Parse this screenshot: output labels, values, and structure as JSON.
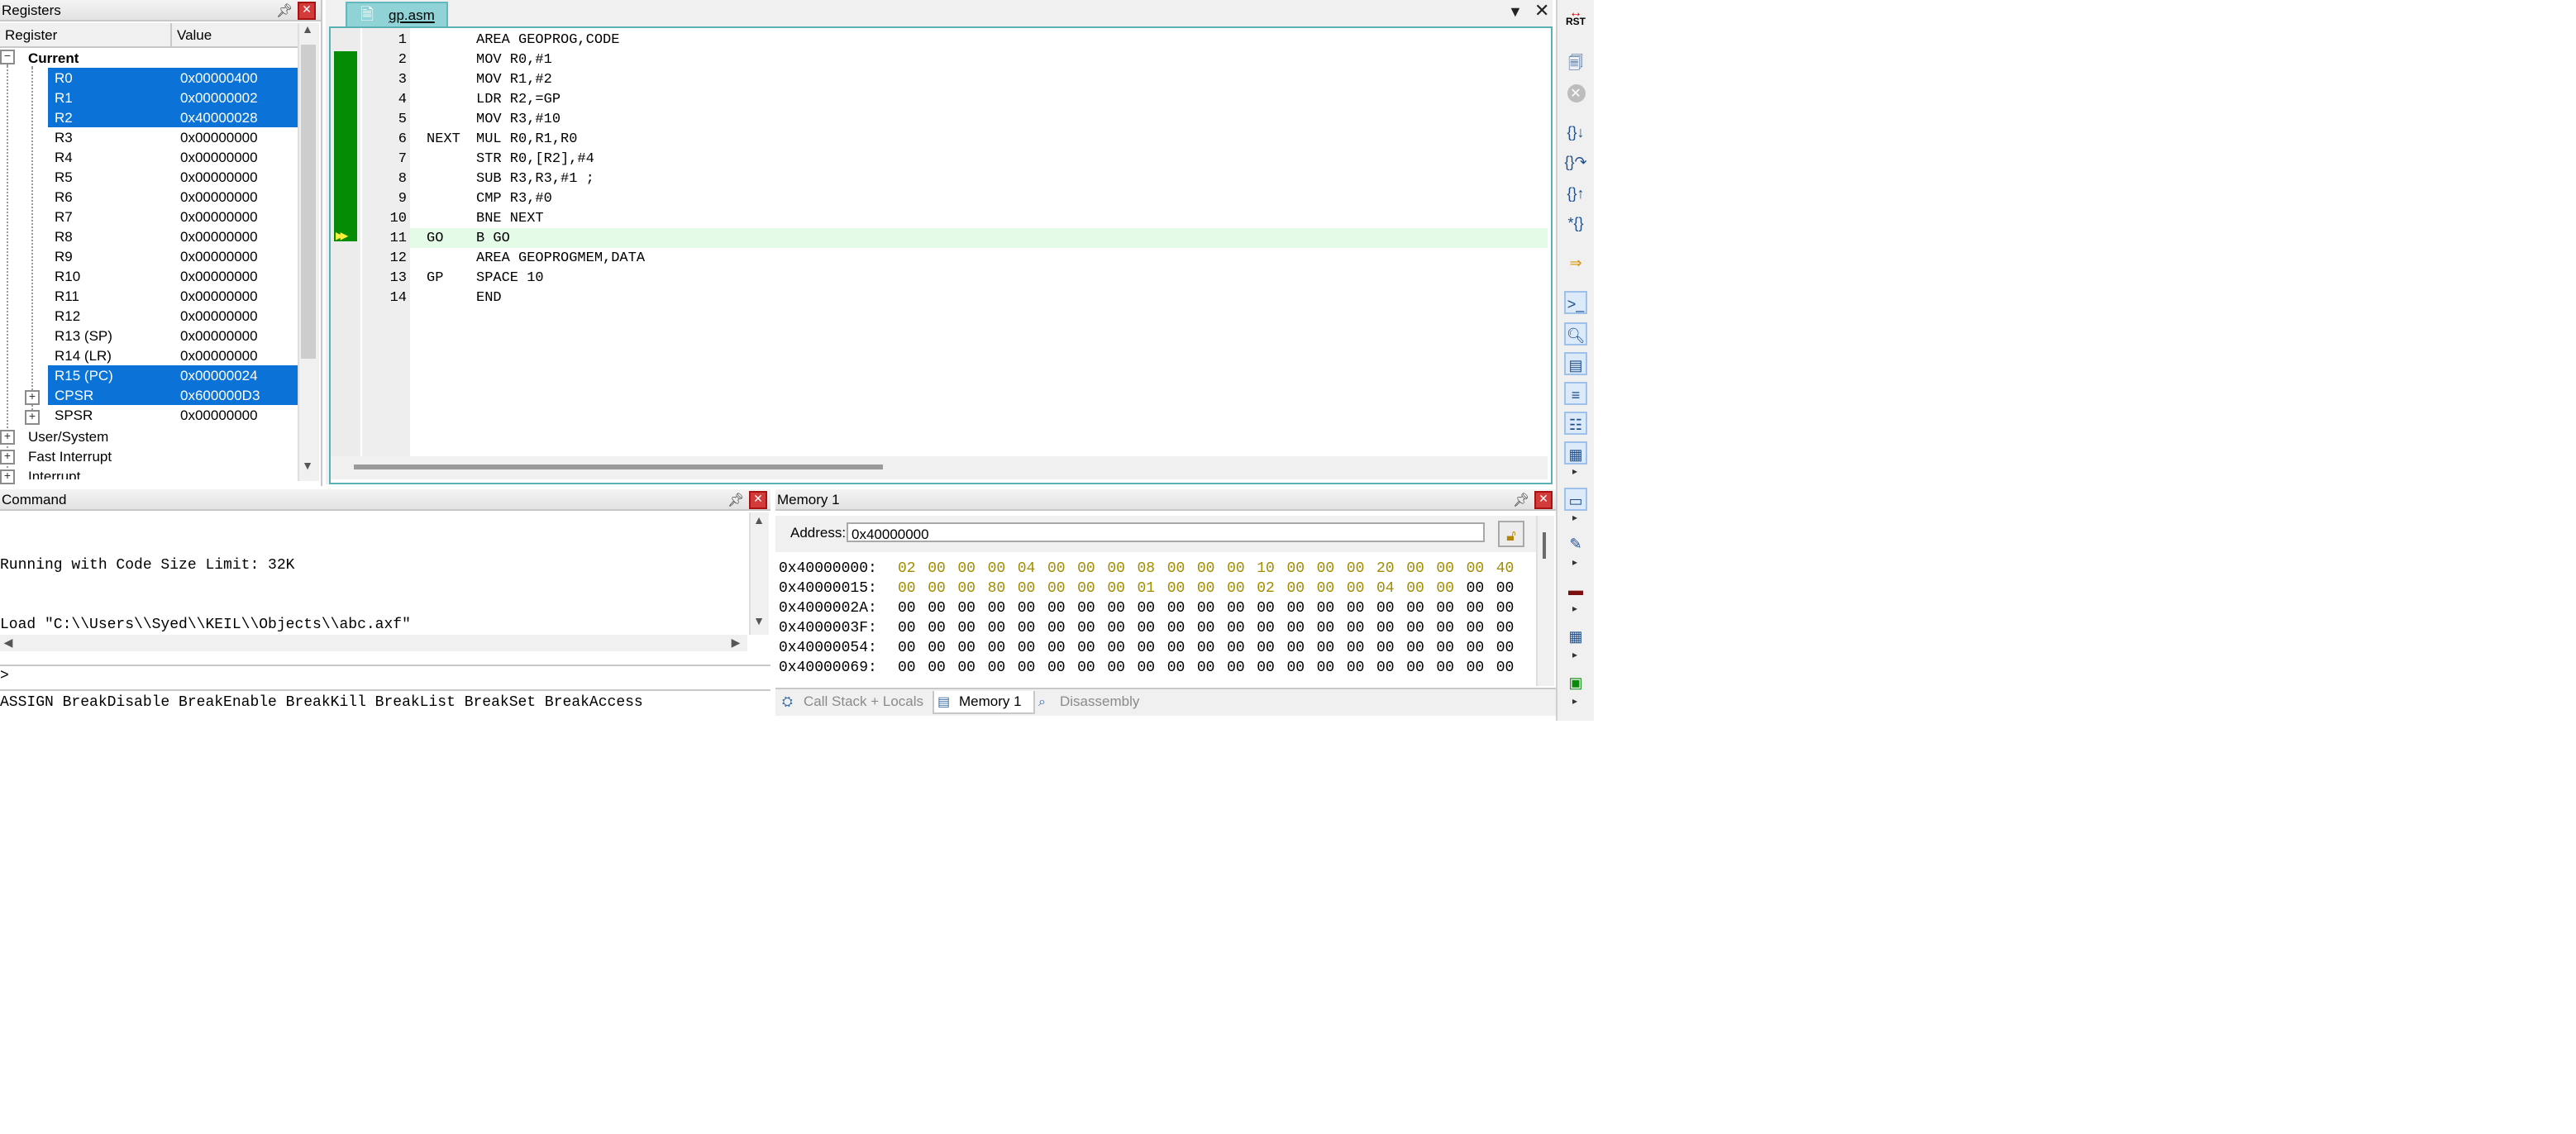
{
  "registers": {
    "title": "Registers",
    "col_register": "Register",
    "col_value": "Value",
    "current_label": "Current",
    "rows": [
      {
        "name": "R0",
        "value": "0x00000400",
        "selected": true
      },
      {
        "name": "R1",
        "value": "0x00000002",
        "selected": true
      },
      {
        "name": "R2",
        "value": "0x40000028",
        "selected": true
      },
      {
        "name": "R3",
        "value": "0x00000000",
        "selected": false
      },
      {
        "name": "R4",
        "value": "0x00000000",
        "selected": false
      },
      {
        "name": "R5",
        "value": "0x00000000",
        "selected": false
      },
      {
        "name": "R6",
        "value": "0x00000000",
        "selected": false
      },
      {
        "name": "R7",
        "value": "0x00000000",
        "selected": false
      },
      {
        "name": "R8",
        "value": "0x00000000",
        "selected": false
      },
      {
        "name": "R9",
        "value": "0x00000000",
        "selected": false
      },
      {
        "name": "R10",
        "value": "0x00000000",
        "selected": false
      },
      {
        "name": "R11",
        "value": "0x00000000",
        "selected": false
      },
      {
        "name": "R12",
        "value": "0x00000000",
        "selected": false
      },
      {
        "name": "R13 (SP)",
        "value": "0x00000000",
        "selected": false
      },
      {
        "name": "R14 (LR)",
        "value": "0x00000000",
        "selected": false
      },
      {
        "name": "R15 (PC)",
        "value": "0x00000024",
        "selected": true
      },
      {
        "name": "CPSR",
        "value": "0x600000D3",
        "selected": true
      },
      {
        "name": "SPSR",
        "value": "0x00000000",
        "selected": false
      }
    ],
    "groups": [
      "User/System",
      "Fast Interrupt",
      "Interrupt"
    ]
  },
  "editor": {
    "tab_label": "gp.asm",
    "current_line": 11,
    "lines": [
      {
        "n": "1",
        "label": "",
        "instr": "AREA GEOPROG,CODE"
      },
      {
        "n": "2",
        "label": "",
        "instr": "MOV R0,#1"
      },
      {
        "n": "3",
        "label": "",
        "instr": "MOV R1,#2"
      },
      {
        "n": "4",
        "label": "",
        "instr": "LDR R2,=GP"
      },
      {
        "n": "5",
        "label": "",
        "instr": "MOV R3,#10"
      },
      {
        "n": "6",
        "label": "NEXT",
        "instr": "MUL R0,R1,R0"
      },
      {
        "n": "7",
        "label": "",
        "instr": "STR R0,[R2],#4"
      },
      {
        "n": "8",
        "label": "",
        "instr": "SUB R3,R3,#1 ;"
      },
      {
        "n": "9",
        "label": "",
        "instr": "CMP R3,#0"
      },
      {
        "n": "10",
        "label": "",
        "instr": "BNE NEXT"
      },
      {
        "n": "11",
        "label": "GO",
        "instr": "B GO"
      },
      {
        "n": "12",
        "label": "",
        "instr": "AREA GEOPROGMEM,DATA"
      },
      {
        "n": "13",
        "label": "GP",
        "instr": "SPACE 10"
      },
      {
        "n": "14",
        "label": "",
        "instr": "END"
      }
    ]
  },
  "toolbar": {
    "icons": [
      "rst-icon",
      "reload-icon",
      "stop-icon",
      "step-into-icon",
      "step-over-icon",
      "step-out-icon",
      "run-to-cursor-icon",
      "show-next-statement-icon",
      "command-window-icon",
      "disassembly-window-icon",
      "symbols-window-icon",
      "registers-window-icon",
      "call-stack-window-icon",
      "watch-window-icon",
      "memory-window-icon",
      "serial-window-icon",
      "analysis-window-icon",
      "trace-window-icon",
      "system-viewer-icon",
      "toolbox-icon"
    ],
    "rst_label": "RST"
  },
  "command": {
    "title": "Command",
    "output": [
      "Running with Code Size Limit: 32K",
      "Load \"C:\\\\Users\\\\Syed\\\\KEIL\\\\Objects\\\\abc.axf\""
    ],
    "prompt": ">",
    "hint": "ASSIGN BreakDisable BreakEnable BreakKill BreakList BreakSet BreakAccess"
  },
  "memory": {
    "title": "Memory 1",
    "address_label": "Address:",
    "address_value": "0x40000000",
    "rows": [
      {
        "addr": "0x40000000:",
        "bytes": [
          "02",
          "00",
          "00",
          "00",
          "04",
          "00",
          "00",
          "00",
          "08",
          "00",
          "00",
          "00",
          "10",
          "00",
          "00",
          "00",
          "20",
          "00",
          "00",
          "00",
          "40"
        ],
        "changed_upto": 21
      },
      {
        "addr": "0x40000015:",
        "bytes": [
          "00",
          "00",
          "00",
          "80",
          "00",
          "00",
          "00",
          "00",
          "01",
          "00",
          "00",
          "00",
          "02",
          "00",
          "00",
          "00",
          "04",
          "00",
          "00",
          "00",
          "00"
        ],
        "changed_upto": 19
      },
      {
        "addr": "0x4000002A:",
        "bytes": [
          "00",
          "00",
          "00",
          "00",
          "00",
          "00",
          "00",
          "00",
          "00",
          "00",
          "00",
          "00",
          "00",
          "00",
          "00",
          "00",
          "00",
          "00",
          "00",
          "00",
          "00"
        ],
        "changed_upto": 0
      },
      {
        "addr": "0x4000003F:",
        "bytes": [
          "00",
          "00",
          "00",
          "00",
          "00",
          "00",
          "00",
          "00",
          "00",
          "00",
          "00",
          "00",
          "00",
          "00",
          "00",
          "00",
          "00",
          "00",
          "00",
          "00",
          "00"
        ],
        "changed_upto": 0
      },
      {
        "addr": "0x40000054:",
        "bytes": [
          "00",
          "00",
          "00",
          "00",
          "00",
          "00",
          "00",
          "00",
          "00",
          "00",
          "00",
          "00",
          "00",
          "00",
          "00",
          "00",
          "00",
          "00",
          "00",
          "00",
          "00"
        ],
        "changed_upto": 0
      },
      {
        "addr": "0x40000069:",
        "bytes": [
          "00",
          "00",
          "00",
          "00",
          "00",
          "00",
          "00",
          "00",
          "00",
          "00",
          "00",
          "00",
          "00",
          "00",
          "00",
          "00",
          "00",
          "00",
          "00",
          "00",
          "00"
        ],
        "changed_upto": 0
      }
    ],
    "tabs": [
      {
        "label": "Call Stack + Locals",
        "active": false,
        "icon": "call-stack-icon"
      },
      {
        "label": "Memory 1",
        "active": true,
        "icon": "memory-icon"
      },
      {
        "label": "Disassembly",
        "active": false,
        "icon": "disassembly-icon"
      }
    ]
  },
  "colors": {
    "selection": "#0b73d8",
    "pc_marker": "#058c05",
    "current_line_bg": "#e4fbe8",
    "changed_byte": "#a28c00",
    "tab_accent": "#8fd3d6"
  }
}
